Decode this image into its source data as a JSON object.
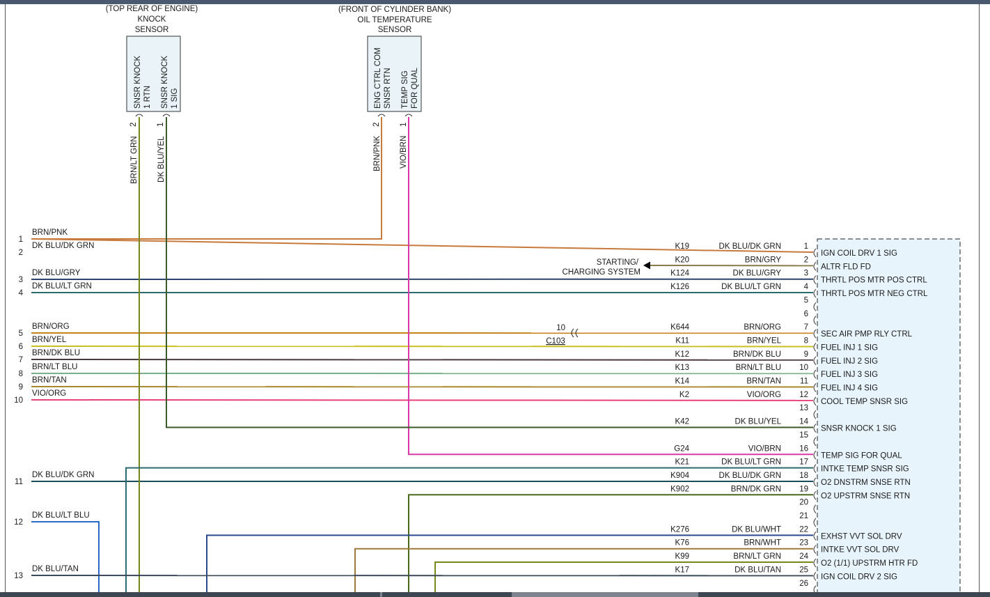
{
  "colors": {
    "BRN/PNK": "#c87a3c",
    "DK BLU/DK GRN": "#1a4e5c",
    "DK BLU/GRY": "#2c4470",
    "DK BLU/LT GRN": "#2a6a70",
    "BRN/ORG": "#c8821c",
    "BRN/YEL": "#c8c020",
    "BRN/DK BLU": "#4a3a40",
    "BRN/LT BLU": "#7ab08a",
    "BRN/TAN": "#a8882a",
    "VIO/ORG": "#e8407a",
    "DK BLU/YEL": "#3a5a2a",
    "VIO/BRN": "#d838a8",
    "BRN/LT GRN": "#788818",
    "BRN/DK GRN": "#4a6a1a",
    "DK BLU/LT BLU": "#2a6ac8",
    "DK BLU/WHT": "#2a4a8a",
    "BRN/WHT": "#a07a3a",
    "DK BLU/TAN": "#3a4a5a",
    "BRN/GRY": "#8a7a4a",
    "module_fill": "#e8f4fc",
    "sensor_fill": "#eaf4f8",
    "frame": "#555555"
  },
  "knock_sensor": {
    "title_lines": [
      "(TOP REAR OF ENGINE)",
      "KNOCK",
      "SENSOR"
    ],
    "pins": [
      {
        "num": "2",
        "label1": "SNSR KNOCK",
        "label2": "1 RTN",
        "wire": "BRN/LT GRN"
      },
      {
        "num": "1",
        "label1": "SNSR KNOCK",
        "label2": "1 SIG",
        "wire": "DK BLU/YEL"
      }
    ]
  },
  "oil_temp_sensor": {
    "title_lines": [
      "(FRONT OF CYLINDER BANK)",
      "OIL TEMPERATURE",
      "SENSOR"
    ],
    "pins": [
      {
        "num": "2",
        "label1": "ENG CTRL COM",
        "label2": "SNSR RTN",
        "wire": "BRN/PNK"
      },
      {
        "num": "1",
        "label1": "TEMP SIG",
        "label2": "FOR QUAL",
        "wire": "VIO/BRN"
      }
    ]
  },
  "left_wires": [
    {
      "num": "1",
      "color": "BRN/PNK"
    },
    {
      "num": "2",
      "color": "DK BLU/DK GRN"
    },
    {
      "num": "3",
      "color": "DK BLU/GRY"
    },
    {
      "num": "4",
      "color": "DK BLU/LT GRN"
    },
    {
      "num": "5",
      "color": "BRN/ORG"
    },
    {
      "num": "6",
      "color": "BRN/YEL"
    },
    {
      "num": "7",
      "color": "BRN/DK BLU"
    },
    {
      "num": "8",
      "color": "BRN/LT BLU"
    },
    {
      "num": "9",
      "color": "BRN/TAN"
    },
    {
      "num": "10",
      "color": "VIO/ORG"
    },
    {
      "num": "11",
      "color": "DK BLU/DK GRN"
    },
    {
      "num": "12",
      "color": "DK BLU/LT BLU"
    },
    {
      "num": "13",
      "color": "DK BLU/TAN"
    }
  ],
  "starting_system": {
    "line1": "STARTING/",
    "line2": "CHARGING SYSTEM"
  },
  "connector_c103": {
    "pin": "10",
    "name": "C103"
  },
  "module_pins": [
    {
      "pin": "1",
      "circuit": "K19",
      "color": "DK BLU/DK GRN",
      "function": "IGN COIL DRV 1 SIG"
    },
    {
      "pin": "2",
      "circuit": "K20",
      "color": "BRN/GRY",
      "function": "ALTR FLD FD"
    },
    {
      "pin": "3",
      "circuit": "K124",
      "color": "DK BLU/GRY",
      "function": "THRTL POS MTR POS CTRL"
    },
    {
      "pin": "4",
      "circuit": "K126",
      "color": "DK BLU/LT GRN",
      "function": "THRTL POS MTR NEG CTRL"
    },
    {
      "pin": "5",
      "circuit": "",
      "color": "",
      "function": ""
    },
    {
      "pin": "6",
      "circuit": "",
      "color": "",
      "function": ""
    },
    {
      "pin": "7",
      "circuit": "K644",
      "color": "BRN/ORG",
      "function": "SEC AIR PMP RLY CTRL"
    },
    {
      "pin": "8",
      "circuit": "K11",
      "color": "BRN/YEL",
      "function": "FUEL INJ 1 SIG"
    },
    {
      "pin": "9",
      "circuit": "K12",
      "color": "BRN/DK BLU",
      "function": "FUEL INJ 2 SIG"
    },
    {
      "pin": "10",
      "circuit": "K13",
      "color": "BRN/LT BLU",
      "function": "FUEL INJ 3 SIG"
    },
    {
      "pin": "11",
      "circuit": "K14",
      "color": "BRN/TAN",
      "function": "FUEL INJ 4 SIG"
    },
    {
      "pin": "12",
      "circuit": "K2",
      "color": "VIO/ORG",
      "function": "COOL TEMP SNSR SIG"
    },
    {
      "pin": "13",
      "circuit": "",
      "color": "",
      "function": ""
    },
    {
      "pin": "14",
      "circuit": "K42",
      "color": "DK BLU/YEL",
      "function": "SNSR KNOCK 1 SIG"
    },
    {
      "pin": "15",
      "circuit": "",
      "color": "",
      "function": ""
    },
    {
      "pin": "16",
      "circuit": "G24",
      "color": "VIO/BRN",
      "function": "TEMP SIG FOR QUAL"
    },
    {
      "pin": "17",
      "circuit": "K21",
      "color": "DK BLU/LT GRN",
      "function": "INTKE TEMP SNSR SIG"
    },
    {
      "pin": "18",
      "circuit": "K904",
      "color": "DK BLU/DK GRN",
      "function": "O2 DNSTRM SNSE RTN"
    },
    {
      "pin": "19",
      "circuit": "K902",
      "color": "BRN/DK GRN",
      "function": "O2 UPSTRM SNSE RTN"
    },
    {
      "pin": "20",
      "circuit": "",
      "color": "",
      "function": ""
    },
    {
      "pin": "21",
      "circuit": "",
      "color": "",
      "function": ""
    },
    {
      "pin": "22",
      "circuit": "K276",
      "color": "DK BLU/WHT",
      "function": "EXHST VVT SOL DRV"
    },
    {
      "pin": "23",
      "circuit": "K76",
      "color": "BRN/WHT",
      "function": "INTKE VVT SOL DRV"
    },
    {
      "pin": "24",
      "circuit": "K99",
      "color": "BRN/LT GRN",
      "function": "O2 (1/1) UPSTRM HTR FD"
    },
    {
      "pin": "25",
      "circuit": "K17",
      "color": "DK BLU/TAN",
      "function": "IGN COIL DRV 2 SIG"
    },
    {
      "pin": "26",
      "circuit": "",
      "color": "",
      "function": ""
    }
  ]
}
